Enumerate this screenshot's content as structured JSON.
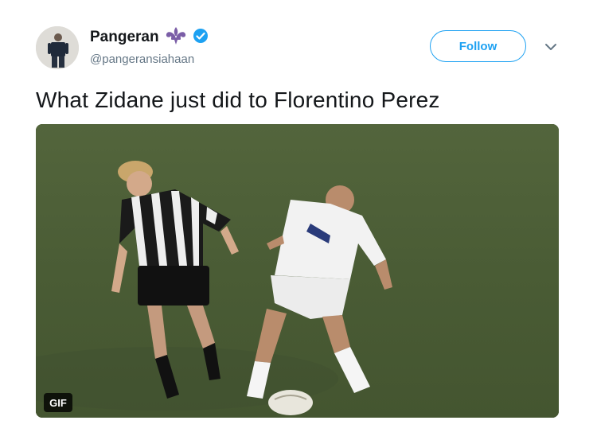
{
  "tweet": {
    "author": {
      "display_name": "Pangeran",
      "handle": "@pangeransiahaan",
      "verified": true,
      "emblem": "fleur-de-lis-icon"
    },
    "follow_label": "Follow",
    "text": "What Zidane just did to Florentino Perez",
    "media": {
      "type": "gif",
      "badge": "GIF"
    }
  },
  "colors": {
    "accent": "#1da1f2",
    "text_primary": "#14171a",
    "text_secondary": "#657786",
    "emblem": "#7b5ea7"
  }
}
